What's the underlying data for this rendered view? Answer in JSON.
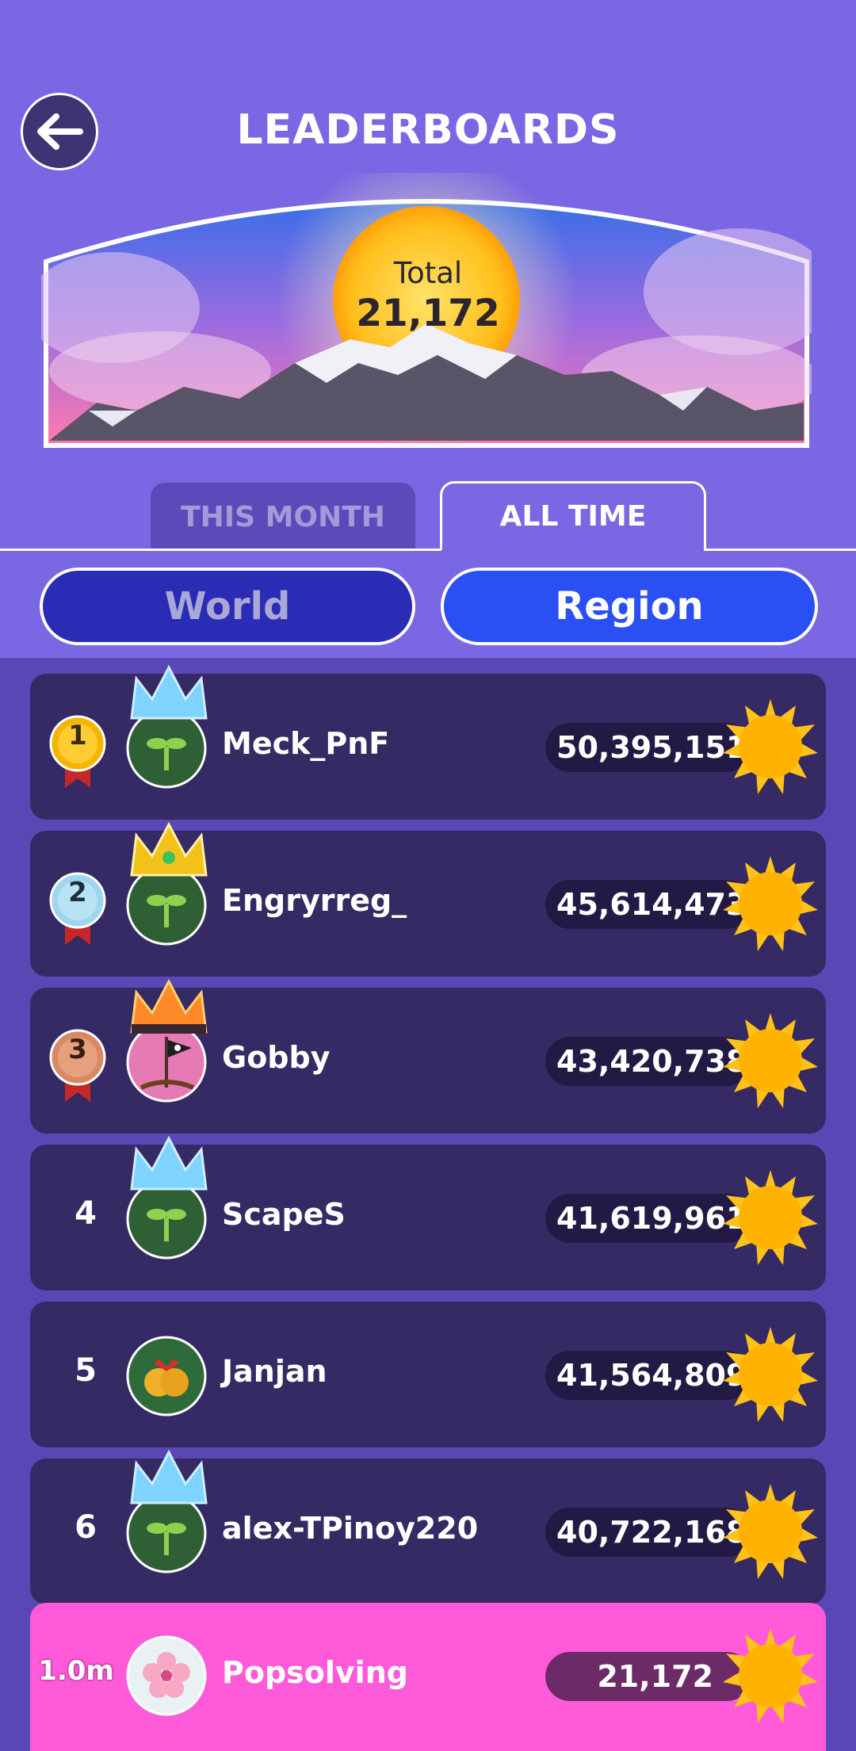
{
  "header": {
    "title": "LEADERBOARDS",
    "total_label": "Total",
    "total_value": "21,172"
  },
  "tabs": [
    {
      "label": "THIS MONTH",
      "selected": false
    },
    {
      "label": "ALL TIME",
      "selected": true
    }
  ],
  "scope": [
    {
      "label": "World",
      "selected": false
    },
    {
      "label": "Region",
      "selected": true
    }
  ],
  "leaderboard": [
    {
      "rank": "1",
      "name": "Meck_PnF",
      "score": "50,395,151",
      "medal": "gold",
      "crown": "ice-crown-icon"
    },
    {
      "rank": "2",
      "name": "Engryrreg_",
      "score": "45,614,473",
      "medal": "silver",
      "crown": "gold-crown-icon"
    },
    {
      "rank": "3",
      "name": "Gobby",
      "score": "43,420,738",
      "medal": "bronze",
      "crown": "fire-crown-icon"
    },
    {
      "rank": "4",
      "name": "ScapeS",
      "score": "41,619,961",
      "medal": "",
      "crown": "ice-crown-icon"
    },
    {
      "rank": "5",
      "name": "Janjan",
      "score": "41,564,809",
      "medal": "",
      "crown": ""
    },
    {
      "rank": "6",
      "name": "alex-TPinoy220",
      "score": "40,722,168",
      "medal": "",
      "crown": "ice-crown-icon"
    }
  ],
  "current_user": {
    "rank": "1.0m",
    "name": "Popsolving",
    "score": "21,172"
  },
  "colors": {
    "background": "#7a66e2",
    "row": "#352a64",
    "current_user_row": "#ff5ad9",
    "region_button": "#2a4ff2",
    "world_button": "#2a2cb5"
  }
}
